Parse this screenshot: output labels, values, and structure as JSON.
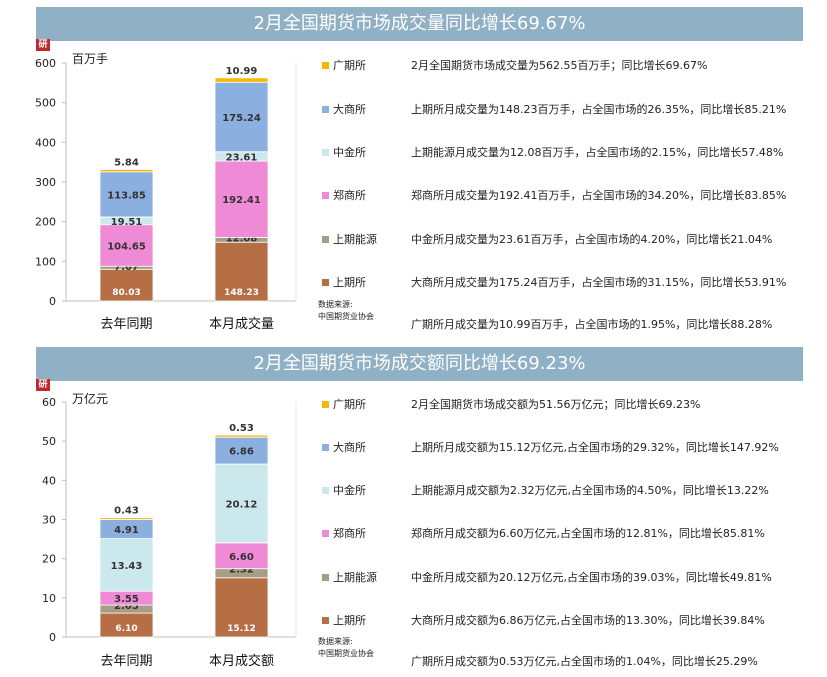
{
  "colors": {
    "banner": "#8fb0c5",
    "广期所": "#f5b800",
    "大商所": "#8bb0df",
    "中金所": "#cbe9ec",
    "郑商所": "#ef8ad6",
    "上期能源": "#a39e84",
    "上期所": "#b66e45"
  },
  "source": {
    "label": "数据来源:",
    "org": "中国期货业协会"
  },
  "chart_data": [
    {
      "type": "bar",
      "stacked": true,
      "title": "2月全国期货市场成交量同比增长69.67%",
      "ylabel": "百万手",
      "ylim": [
        0,
        600
      ],
      "yticks": [
        0,
        100,
        200,
        300,
        400,
        500,
        600
      ],
      "categories": [
        "去年同期",
        "本月成交量"
      ],
      "series": [
        {
          "name": "上期所",
          "values": [
            80.03,
            148.23
          ]
        },
        {
          "name": "上期能源",
          "values": [
            7.67,
            12.08
          ]
        },
        {
          "name": "郑商所",
          "values": [
            104.65,
            192.41
          ]
        },
        {
          "name": "中金所",
          "values": [
            19.51,
            23.61
          ]
        },
        {
          "name": "大商所",
          "values": [
            113.85,
            175.24
          ]
        },
        {
          "name": "广期所",
          "values": [
            5.84,
            10.99
          ]
        }
      ],
      "labels": [
        [
          "80.03",
          "148.23"
        ],
        [
          "7.67",
          "12.08"
        ],
        [
          "104.65",
          "192.41"
        ],
        [
          "19.51",
          "23.61"
        ],
        [
          "113.85",
          "175.24"
        ],
        [
          "5.84",
          "10.99"
        ]
      ],
      "legend": [
        "广期所",
        "大商所",
        "中金所",
        "郑商所",
        "上期能源",
        "上期所"
      ],
      "legend_position": "right",
      "notes": [
        "2月全国期货市场成交量为562.55百万手；同比增长69.67%",
        "上期所月成交量为148.23百万手，占全国市场的26.35%，同比增长85.21%",
        "上期能源月成交量为12.08百万手，占全国市场的2.15%，同比增长57.48%",
        "郑商所月成交量为192.41百万手，占全国市场的34.20%，同比增长83.85%",
        "中金所月成交量为23.61百万手，占全国市场的4.20%，同比增长21.04%",
        "大商所月成交量为175.24百万手，占全国市场的31.15%，同比增长53.91%",
        "广期所月成交量为10.99百万手，占全国市场的1.95%，同比增长88.28%"
      ]
    },
    {
      "type": "bar",
      "stacked": true,
      "title": "2月全国期货市场成交额同比增长69.23%",
      "ylabel": "万亿元",
      "ylim": [
        0,
        60
      ],
      "yticks": [
        0,
        10,
        20,
        30,
        40,
        50,
        60
      ],
      "categories": [
        "去年同期",
        "本月成交额"
      ],
      "series": [
        {
          "name": "上期所",
          "values": [
            6.1,
            15.12
          ]
        },
        {
          "name": "上期能源",
          "values": [
            2.05,
            2.32
          ]
        },
        {
          "name": "郑商所",
          "values": [
            3.55,
            6.6
          ]
        },
        {
          "name": "中金所",
          "values": [
            13.43,
            20.12
          ]
        },
        {
          "name": "大商所",
          "values": [
            4.91,
            6.86
          ]
        },
        {
          "name": "广期所",
          "values": [
            0.43,
            0.53
          ]
        }
      ],
      "labels": [
        [
          "6.10",
          "15.12"
        ],
        [
          "2.05",
          "2.32"
        ],
        [
          "3.55",
          "6.60"
        ],
        [
          "13.43",
          "20.12"
        ],
        [
          "4.91",
          "6.86"
        ],
        [
          "0.43",
          "0.53"
        ]
      ],
      "legend": [
        "广期所",
        "大商所",
        "中金所",
        "郑商所",
        "上期能源",
        "上期所"
      ],
      "legend_position": "right",
      "notes": [
        "2月全国期货市场成交额为51.56万亿元；同比增长69.23%",
        "上期所月成交额为15.12万亿元,占全国市场的29.32%，同比增长147.92%",
        "上期能源月成交额为2.32万亿元,占全国市场的4.50%，同比增长13.22%",
        "郑商所月成交额为6.60万亿元,占全国市场的12.81%，同比增长85.81%",
        "中金所月成交额为20.12万亿元,占全国市场的39.03%，同比增长49.81%",
        "大商所月成交额为6.86万亿元,占全国市场的13.30%，同比增长39.84%",
        "广期所月成交额为0.53万亿元,占全国市场的1.04%，同比增长25.29%"
      ]
    }
  ]
}
